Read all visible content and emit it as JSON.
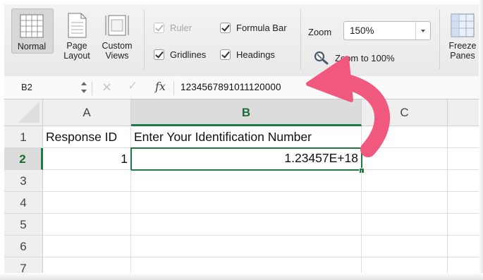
{
  "ribbon": {
    "views": [
      {
        "label_line1": "Normal",
        "label_line2": "",
        "selected": true
      },
      {
        "label_line1": "Page",
        "label_line2": "Layout",
        "selected": false
      },
      {
        "label_line1": "Custom",
        "label_line2": "Views",
        "selected": false
      }
    ],
    "show": {
      "ruler": {
        "label": "Ruler",
        "checked": true,
        "enabled": false
      },
      "formula_bar": {
        "label": "Formula Bar",
        "checked": true,
        "enabled": true
      },
      "gridlines": {
        "label": "Gridlines",
        "checked": true,
        "enabled": true
      },
      "headings": {
        "label": "Headings",
        "checked": true,
        "enabled": true
      }
    },
    "zoom": {
      "label": "Zoom",
      "value": "150%",
      "zoom_to_100_label": "Zoom to 100%"
    },
    "freeze": {
      "label_line1": "Freeze",
      "label_line2": "Panes"
    }
  },
  "formula_bar": {
    "name_box": "B2",
    "fx_label": "fx",
    "value": "1234567891011120000"
  },
  "sheet": {
    "columns": [
      "A",
      "B",
      "C"
    ],
    "selected_column": "B",
    "rows": [
      "1",
      "2",
      "3",
      "4",
      "5",
      "6",
      "7"
    ],
    "selected_row": "2",
    "cells": {
      "A1": "Response ID",
      "B1": "Enter Your Identification Number",
      "A2": "1",
      "B2": "1.23457E+18"
    },
    "active_cell": "B2"
  },
  "colors": {
    "accent_green": "#1f7a44",
    "annotation_arrow": "#f0587e"
  }
}
